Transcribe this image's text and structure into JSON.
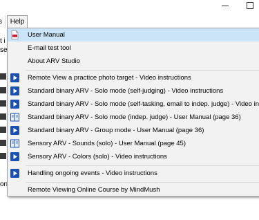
{
  "menubar": {
    "prev_menu_fragment": "s",
    "help_label": "Help"
  },
  "background": {
    "fragment_1": "t i",
    "fragment_2": "se",
    "fragment_3": "on"
  },
  "help_menu": {
    "items": [
      {
        "label": "User Manual",
        "icon": "pdf-icon"
      },
      {
        "label": "E-mail test tool",
        "icon": ""
      },
      {
        "label": "About ARV Studio",
        "icon": ""
      },
      {
        "label": "Remote View a practice photo target - Video instructions",
        "icon": "play-video-icon"
      },
      {
        "label": "Standard binary ARV - Solo mode (self-judging) - Video instructions",
        "icon": "play-video-icon"
      },
      {
        "label": "Standard binary ARV - Solo mode (self-tasking, email to indep. judge) - Video in",
        "icon": "play-video-icon"
      },
      {
        "label": "Standard binary ARV - Solo mode (indep. judge) - User Manual (page 36)",
        "icon": "book-icon"
      },
      {
        "label": "Standard binary ARV - Group mode - User Manual (page 36)",
        "icon": "play-video-icon"
      },
      {
        "label": "Sensory ARV - Sounds (solo) - User Manual (page 45)",
        "icon": "book-icon"
      },
      {
        "label": "Sensory ARV - Colors (solo) - Video instructions",
        "icon": "play-video-icon"
      },
      {
        "label": "Handling ongoing events - Video instructions",
        "icon": "play-video-icon"
      },
      {
        "label": "Remote Viewing Online Course by MindMush",
        "icon": ""
      }
    ],
    "colors": {
      "selected": "#cce4f7",
      "video_icon": "#1b4fb0",
      "pdf_icon": "#c8102e"
    }
  }
}
